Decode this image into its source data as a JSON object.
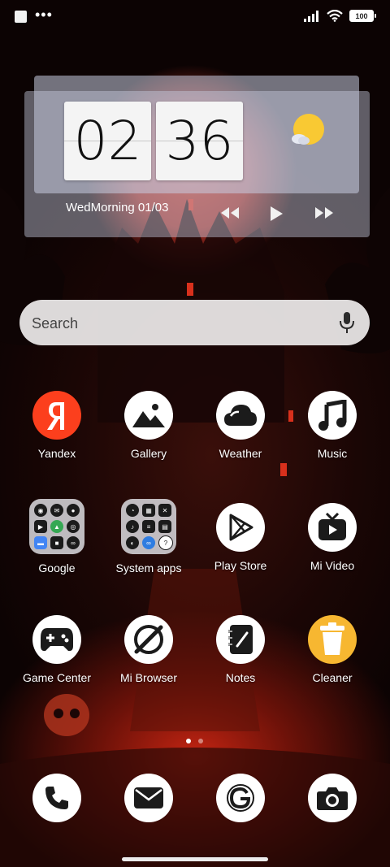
{
  "status_bar": {
    "battery": "100"
  },
  "clock_widget": {
    "hour": "02",
    "minute": "36",
    "date": "WedMorning 01/03"
  },
  "search": {
    "placeholder": "Search"
  },
  "apps_row1": [
    {
      "label": "Yandex",
      "icon": "yandex-icon"
    },
    {
      "label": "Gallery",
      "icon": "gallery-icon"
    },
    {
      "label": "Weather",
      "icon": "weather-icon"
    },
    {
      "label": "Music",
      "icon": "music-icon"
    }
  ],
  "apps_row2": [
    {
      "label": "Google",
      "icon": "google-folder-icon"
    },
    {
      "label": "System apps",
      "icon": "system-apps-folder-icon"
    },
    {
      "label": "Play Store",
      "icon": "play-store-icon"
    },
    {
      "label": "Mi Video",
      "icon": "mi-video-icon"
    }
  ],
  "apps_row3": [
    {
      "label": "Game Center",
      "icon": "game-center-icon"
    },
    {
      "label": "Mi Browser",
      "icon": "mi-browser-icon"
    },
    {
      "label": "Notes",
      "icon": "notes-icon"
    },
    {
      "label": "Cleaner",
      "icon": "cleaner-icon"
    }
  ],
  "dock": [
    {
      "icon": "phone-icon"
    },
    {
      "icon": "messages-icon"
    },
    {
      "icon": "google-search-icon"
    },
    {
      "icon": "camera-icon"
    }
  ],
  "pager": {
    "current": 1,
    "total": 2
  },
  "colors": {
    "yandex_red": "#fc3f1d",
    "cleaner_yellow": "#f7b731",
    "accent_dark": "#1b1b1b"
  }
}
